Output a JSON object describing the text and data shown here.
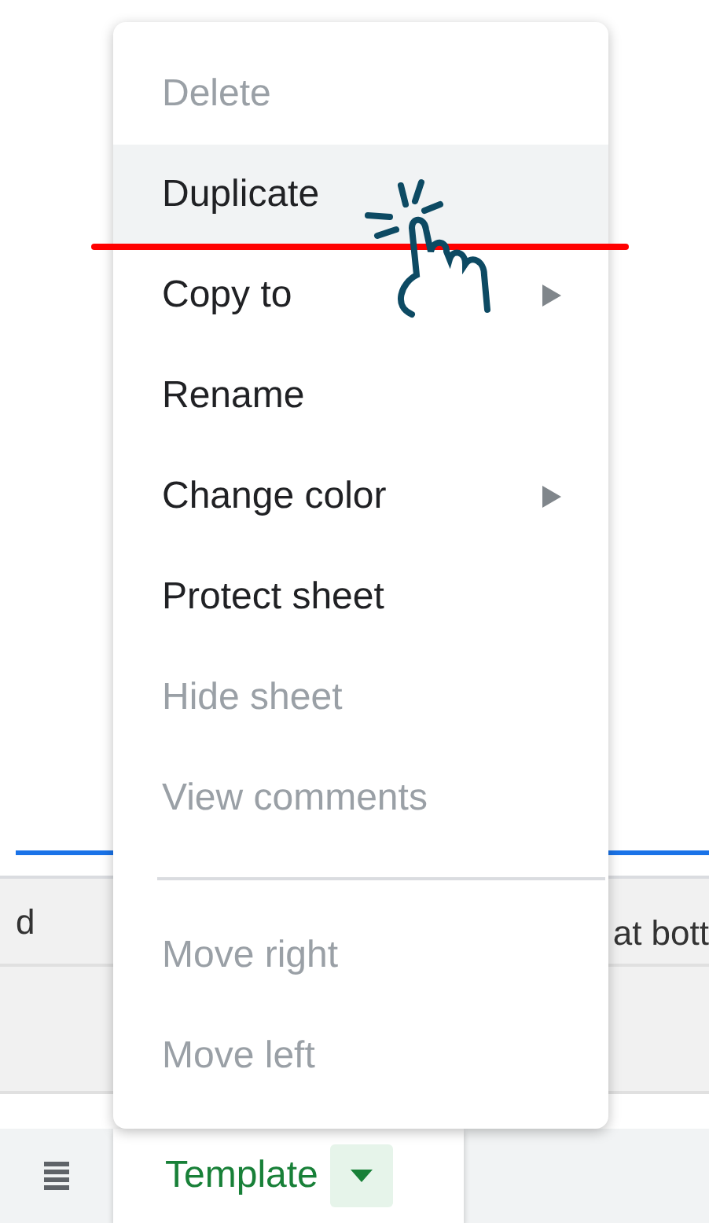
{
  "sheet_area": {
    "left_text": "d",
    "right_text": "at bott"
  },
  "tab_bar": {
    "tabs": [
      {
        "label": "Template",
        "selected": true
      }
    ]
  },
  "context_menu": {
    "groups": [
      [
        {
          "label": "Delete",
          "disabled": true,
          "highlighted": false,
          "submenu": false
        },
        {
          "label": "Duplicate",
          "disabled": false,
          "highlighted": true,
          "submenu": false
        },
        {
          "label": "Copy to",
          "disabled": false,
          "highlighted": false,
          "submenu": true
        },
        {
          "label": "Rename",
          "disabled": false,
          "highlighted": false,
          "submenu": false
        },
        {
          "label": "Change color",
          "disabled": false,
          "highlighted": false,
          "submenu": true
        },
        {
          "label": "Protect sheet",
          "disabled": false,
          "highlighted": false,
          "submenu": false
        },
        {
          "label": "Hide sheet",
          "disabled": true,
          "highlighted": false,
          "submenu": false
        },
        {
          "label": "View comments",
          "disabled": true,
          "highlighted": false,
          "submenu": false
        }
      ],
      [
        {
          "label": "Move right",
          "disabled": true,
          "highlighted": false,
          "submenu": false
        },
        {
          "label": "Move left",
          "disabled": true,
          "highlighted": false,
          "submenu": false
        }
      ]
    ]
  }
}
